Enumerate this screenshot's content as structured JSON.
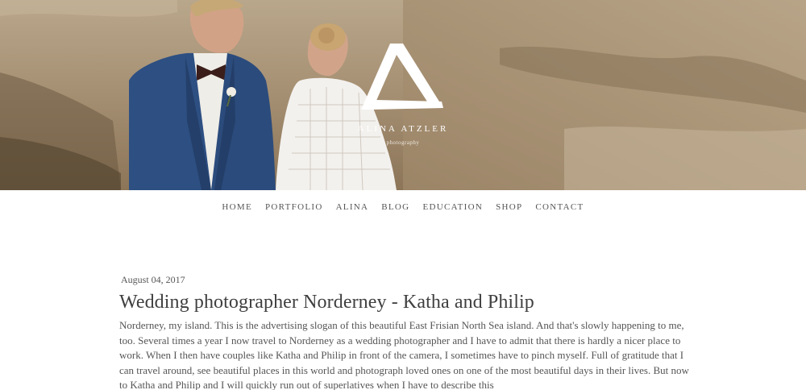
{
  "brand": {
    "name": "ALINA ATZLER",
    "tagline": "photography"
  },
  "hero": {
    "logo_icon": "triangle-a-logo-icon",
    "photo": "couple-on-dunes-photo"
  },
  "nav": {
    "items": [
      {
        "label": "HOME"
      },
      {
        "label": "PORTFOLIO"
      },
      {
        "label": "ALINA"
      },
      {
        "label": "BLOG"
      },
      {
        "label": "EDUCATION"
      },
      {
        "label": "SHOP"
      },
      {
        "label": "CONTACT"
      }
    ]
  },
  "post": {
    "date": "August 04, 2017",
    "title": "Wedding photographer Norderney - Katha and Philip",
    "body": "Norderney, my island. This is the advertising slogan of this beautiful East Frisian North Sea island. And that's slowly happening to me, too. Several times a year I now travel to Norderney as a wedding photographer and I have to admit that there is hardly a nicer place to work. When I then have couples like Katha and Philip in front of the camera, I sometimes have to pinch myself. Full of gratitude that I can travel around, see beautiful places in this world and photograph loved ones on one of the most beautiful days in their lives. But now to Katha and Philip and I will quickly run out of superlatives when I have to describe this"
  },
  "colors": {
    "text": "#555555",
    "title": "#3f3f3f",
    "hero_sand": "#a48e72",
    "logo": "#ffffff"
  }
}
